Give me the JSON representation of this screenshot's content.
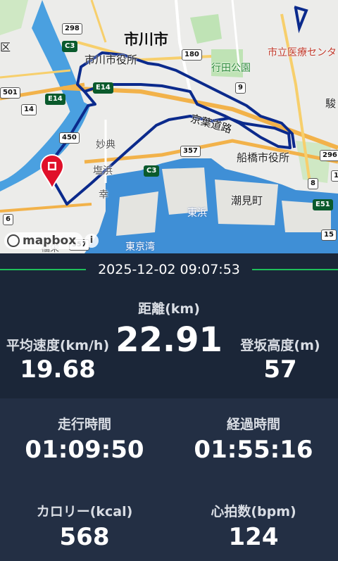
{
  "map": {
    "city_ichikawa": "市川市",
    "ichikawa_office": "市川市役所",
    "gyoda_park": "行田公園",
    "hospital": "市立医療センタ",
    "funabashi_office": "船橋市役所",
    "keiyo_road": "京葉道路",
    "myoden": "妙典",
    "shiohama": "塩浜",
    "saiwai": "幸",
    "higashihama": "東浜",
    "shiomicho": "潮見町",
    "tokyo_bay": "東京湾",
    "fukusaka": "福栄",
    "edge_ku": "区",
    "edge_kan": "駿",
    "shields": [
      "298",
      "C3",
      "180",
      "9",
      "E14",
      "501",
      "14",
      "E14",
      "450",
      "357",
      "C3",
      "296",
      "8",
      "E51",
      "15",
      "6",
      "357",
      "14"
    ],
    "attribution": "mapbox",
    "info": "i"
  },
  "summary": {
    "datetime": "2025-12-02 09:07:53",
    "distance_label": "距離(km)",
    "distance_value": "22.91",
    "avg_speed_label": "平均速度(km/h)",
    "avg_speed_value": "19.68",
    "climb_label": "登坂高度(m)",
    "climb_value": "57",
    "moving_time_label": "走行時間",
    "moving_time_value": "01:09:50",
    "elapsed_time_label": "経過時間",
    "elapsed_time_value": "01:55:16",
    "calories_label": "カロリー(kcal)",
    "calories_value": "568",
    "heart_rate_label": "心拍数(bpm)",
    "heart_rate_value": "124"
  },
  "colors": {
    "route": "#0b2a8c",
    "marker": "#e0102a",
    "accent_line": "#1fbf5a",
    "panel_top": "#1b2638",
    "panel_bottom": "#232f44",
    "water": "#3f8fd6"
  }
}
